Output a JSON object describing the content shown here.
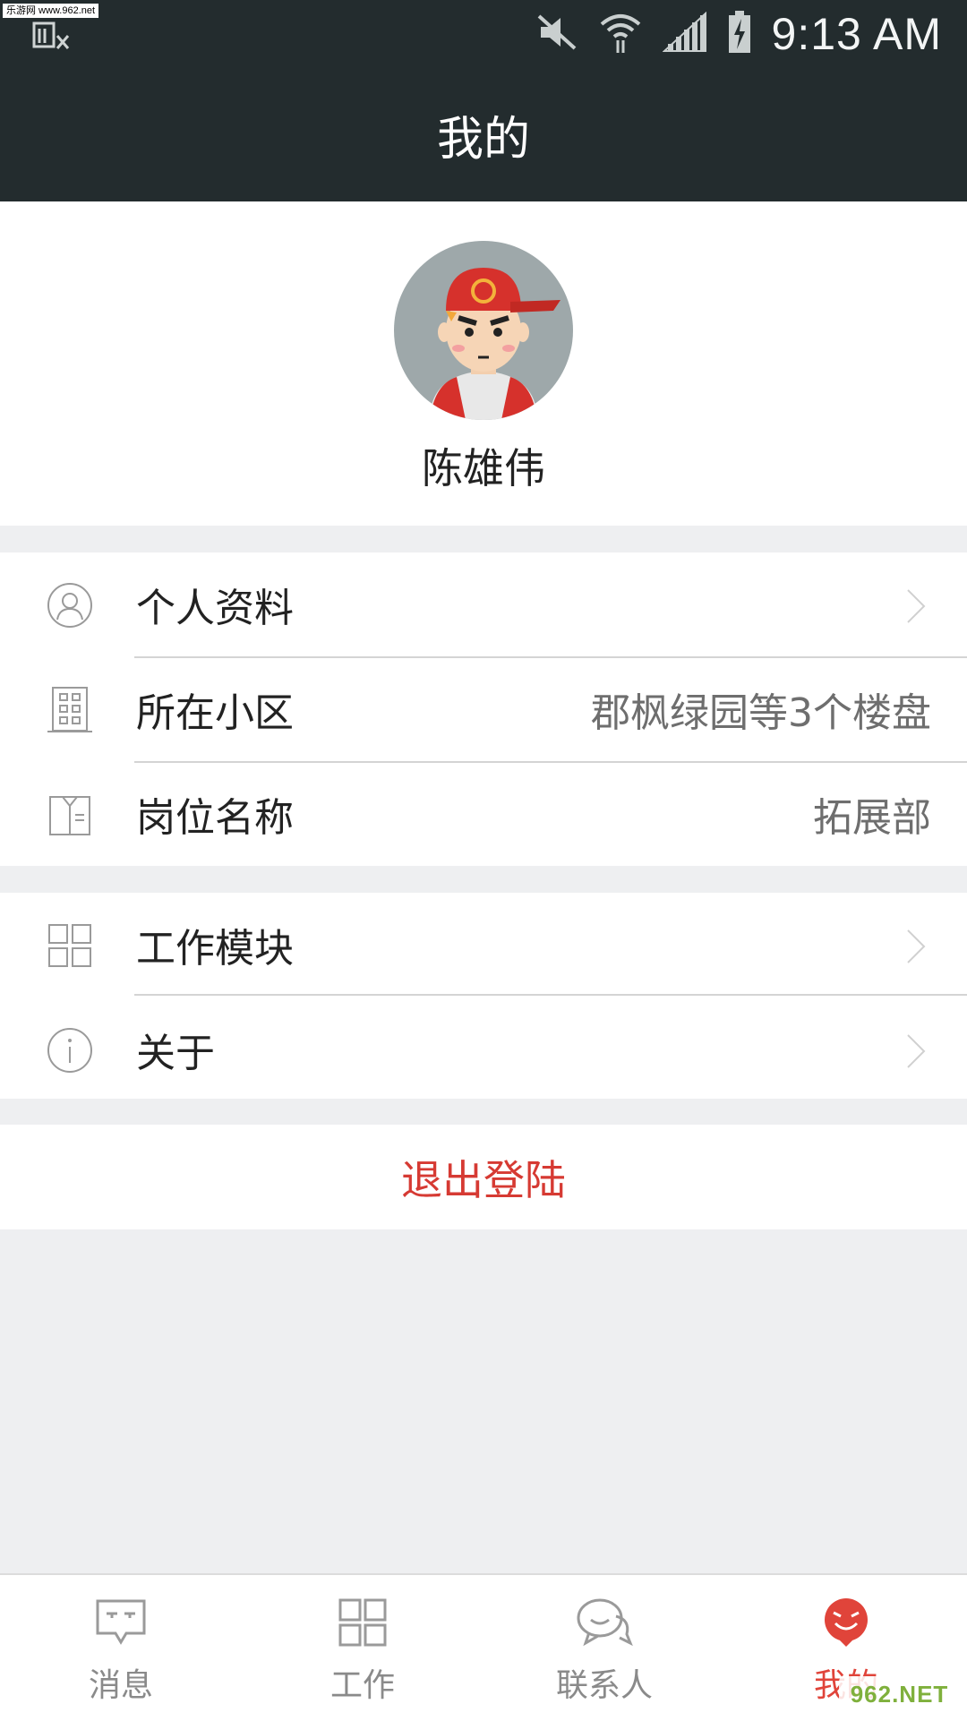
{
  "status_bar": {
    "watermark": "乐游网 www.962.net",
    "time": "9:13 AM"
  },
  "header": {
    "title": "我的"
  },
  "profile": {
    "name": "陈雄伟",
    "avatar_icon": "cartoon-avatar-red-cap"
  },
  "menu_group_1": [
    {
      "label": "个人资料",
      "value": "",
      "icon": "user-circle-icon"
    },
    {
      "label": "所在小区",
      "value": "郡枫绿园等3个楼盘",
      "icon": "building-icon"
    },
    {
      "label": "岗位名称",
      "value": "拓展部",
      "icon": "badge-card-icon"
    }
  ],
  "menu_group_2": [
    {
      "label": "工作模块",
      "icon": "grid-icon"
    },
    {
      "label": "关于",
      "icon": "info-icon"
    }
  ],
  "logout": {
    "label": "退出登陆"
  },
  "tab_bar": {
    "tabs": [
      {
        "label": "消息",
        "icon": "message-icon"
      },
      {
        "label": "工作",
        "icon": "grid-icon"
      },
      {
        "label": "联系人",
        "icon": "contacts-icon"
      },
      {
        "label": "我的",
        "icon": "smile-profile-icon",
        "active": true
      }
    ]
  },
  "corner_watermark": "962.NET",
  "colors": {
    "header_bg": "#232c2e",
    "accent": "#e0443a",
    "logout_text": "#d63a33"
  }
}
